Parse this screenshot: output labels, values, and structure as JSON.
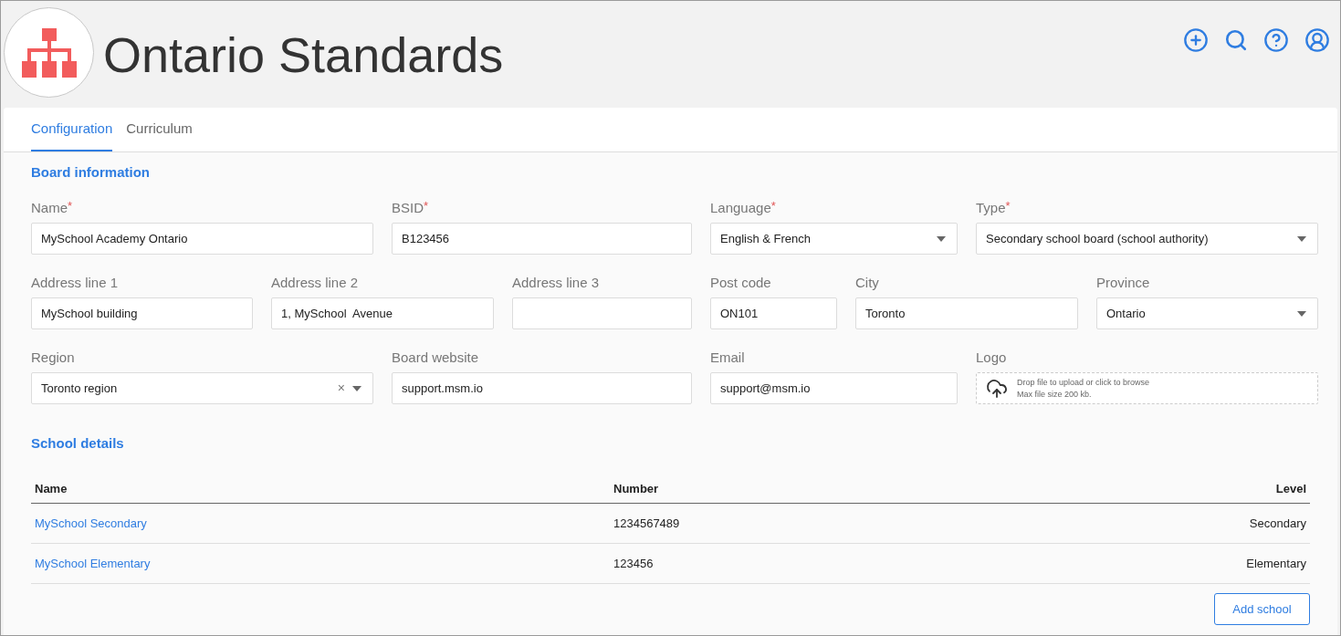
{
  "header": {
    "title": "Ontario Standards"
  },
  "tabs": [
    {
      "label": "Configuration",
      "selected": true
    },
    {
      "label": "Curriculum",
      "selected": false
    }
  ],
  "board": {
    "heading": "Board information",
    "rows": [
      {
        "left": [
          {
            "kind": "text",
            "label": "Name",
            "required_mark": "*",
            "value": "MySchool Academy Ontario"
          },
          {
            "kind": "text",
            "label": "BSID",
            "required_mark": "*",
            "value": "B123456"
          }
        ],
        "right": [
          {
            "kind": "select",
            "label": "Language",
            "required_mark": "*",
            "value": "English & French"
          },
          {
            "kind": "select",
            "label": "Type",
            "required_mark": "*",
            "value": "Secondary school board (school authority)"
          }
        ]
      },
      {
        "left": [
          {
            "kind": "text",
            "label": "Address line 1",
            "value": "MySchool building"
          },
          {
            "kind": "text",
            "label": "Address line 2",
            "value": "1, MySchool  Avenue"
          },
          {
            "kind": "text",
            "label": "Address line 3"
          }
        ],
        "right": [
          {
            "kind": "text",
            "label": "Post code",
            "value": "ON101"
          },
          {
            "kind": "text",
            "label": "City",
            "value": "Toronto"
          },
          {
            "kind": "select",
            "label": "Province",
            "value": "Ontario"
          }
        ]
      },
      {
        "left": [
          {
            "kind": "select",
            "label": "Region",
            "value": "Toronto region",
            "clear": "×"
          },
          {
            "kind": "text",
            "label": "Board website",
            "value": "support.msm.io"
          }
        ],
        "right": [
          {
            "kind": "text",
            "label": "Email",
            "value": "support@msm.io"
          },
          {
            "kind": "file",
            "label": "Logo",
            "hint": "Drop file to upload or click to browse",
            "limit": "Max file size 200 kb."
          }
        ]
      }
    ]
  },
  "schools": {
    "heading": "School details",
    "columns": [
      "Name",
      "Number",
      "Level"
    ],
    "rows": [
      {
        "name": "MySchool Secondary",
        "number": "1234567489",
        "level": "Secondary"
      },
      {
        "name": "MySchool Elementary",
        "number": "123456",
        "level": "Elementary"
      }
    ],
    "add_button": "Add school"
  }
}
